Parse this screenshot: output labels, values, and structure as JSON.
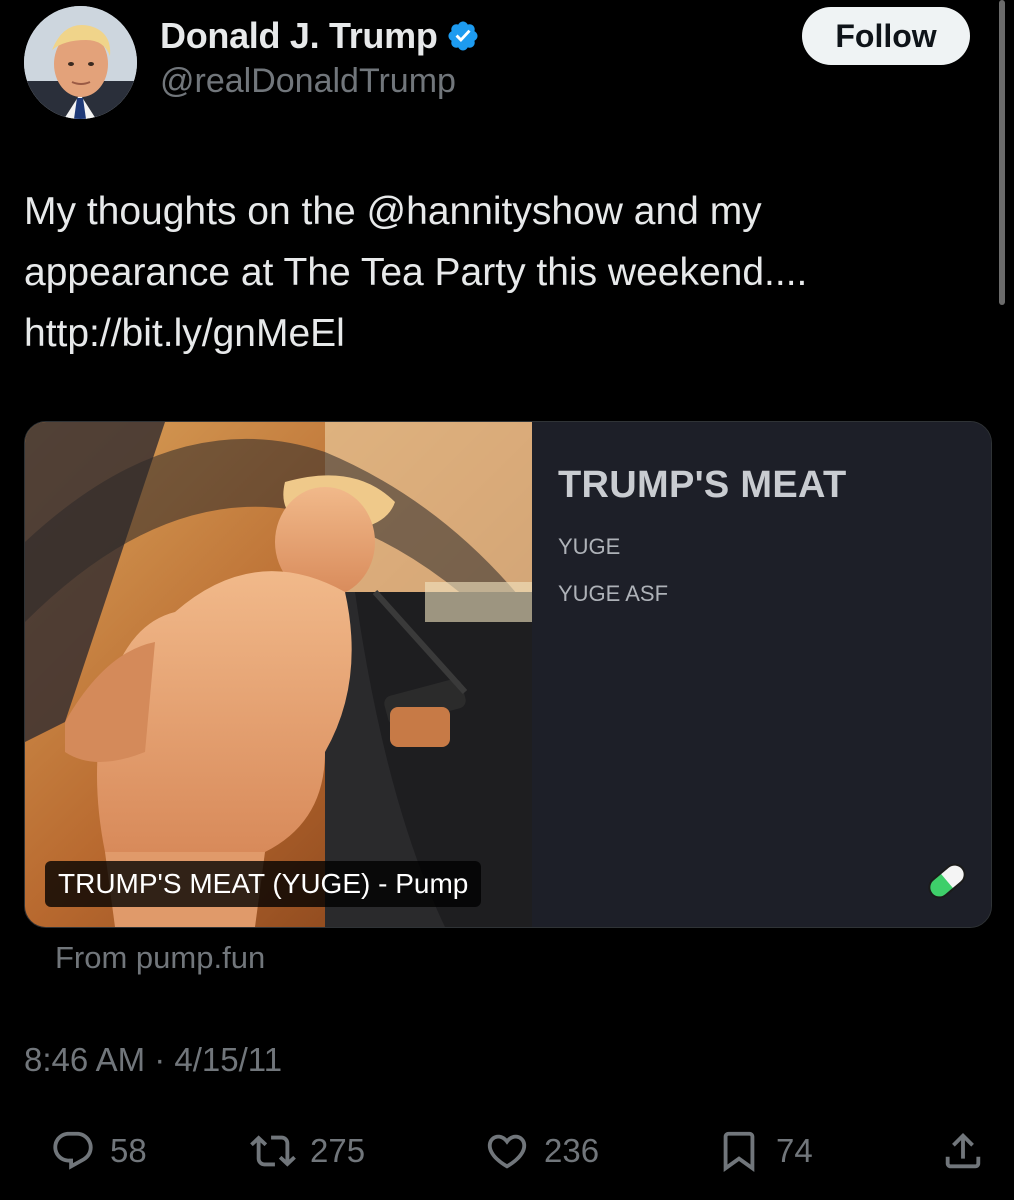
{
  "author": {
    "name": "Donald J. Trump",
    "handle": "@realDonaldTrump",
    "verified": true,
    "avatar_icon": "profile-photo"
  },
  "header": {
    "follow_label": "Follow"
  },
  "tweet": {
    "line1_prefix": "My thoughts on the ",
    "mention": "@hannityshow",
    "line1_suffix": " and my",
    "line2": "appearance at The Tea Party this weekend....",
    "link": "http://bit.ly/gnMeEl"
  },
  "card": {
    "image_caption": "TRUMP'S MEAT (YUGE) - Pump",
    "title": "TRUMP'S MEAT",
    "line1": "YUGE",
    "line2": "YUGE ASF",
    "badge_icon": "pill-icon",
    "source": "From pump.fun"
  },
  "timestamp": "8:46 AM · 4/15/11",
  "actions": {
    "replies": "58",
    "retweets": "275",
    "likes": "236",
    "bookmarks": "74"
  },
  "colors": {
    "background": "#000000",
    "text": "#e7e9ea",
    "muted": "#71767b",
    "verified": "#1d9bf0",
    "card_panel": "#1d1f28"
  }
}
